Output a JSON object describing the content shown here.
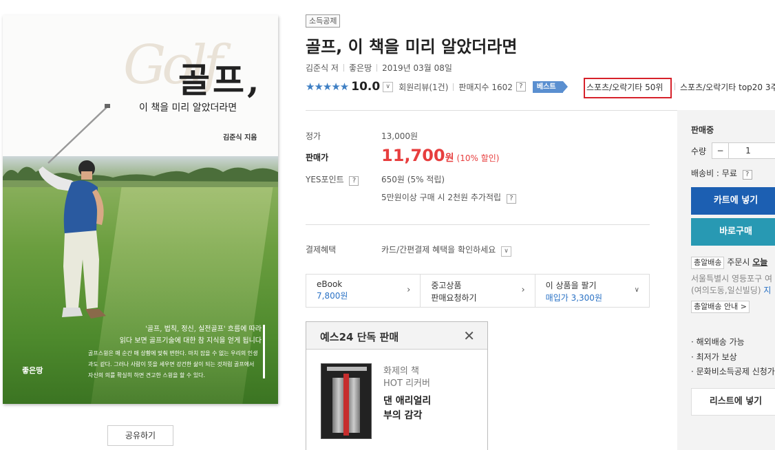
{
  "cover": {
    "script_text": "Golf",
    "title": "골프,",
    "subtitle": "이 책을 미리 알았더라면",
    "author_line": "김준식 지음",
    "blurb_line1": "'골프, 법칙, 정신, 실전골프' 흐름에 따라",
    "blurb_line2": "읽다 보면 골프기술에 대한 참 지식을 얻게 됩니다",
    "blurb_small": "골프스윙은 매 순간 매 상황에 맞춰 변한다. 마치 잡을 수 없는 우리의 인생과도 같다. 그러나 사람이 뜻을 세우면 강건한 삶이 되는 것처럼 골프에서 자신의 의를 확실히 하면 견고한 스윙을 할 수 있다.",
    "publisher_logo": "좋은땅"
  },
  "share_label": "공유하기",
  "tag": "소득공제",
  "title": "골프, 이 책을 미리 알았더라면",
  "author": "김준식 저",
  "publisher": "좋은땅",
  "pub_date": "2019년 03월 08일",
  "rating": {
    "stars": "★★★★★",
    "score": "10.0",
    "review_label": "회원리뷰(1건)",
    "sales_index": "판매지수 1602",
    "q": "?"
  },
  "best_badge": "베스트",
  "rank1": "스포츠/오락기타 50위",
  "rank2": "스포츠/오락기타 top20 3주",
  "price": {
    "list_label": "정가",
    "list_value": "13,000원",
    "sale_label": "판매가",
    "sale_num": "11,700",
    "sale_won": "원",
    "discount": "(10% 할인)",
    "point_label": "YES포인트",
    "point_value": "650원 (5% 적립)",
    "point_extra": "5만원이상 구매 시 2천원 추가적립",
    "pay_label": "결제혜택",
    "pay_value": "카드/간편결제 혜택을 확인하세요"
  },
  "side_options": [
    {
      "title": "eBook",
      "sub": "7,800원"
    },
    {
      "title": "중고상품",
      "sub": "판매요청하기"
    },
    {
      "title": "이 상품을 팔기",
      "sub": "매입가 3,300원"
    }
  ],
  "exclusive": {
    "header": "예스24 단독 판매",
    "line1": "화제의 책",
    "line2": "HOT 리커버",
    "line3": "댄 애리얼리",
    "line4": "부의 감각"
  },
  "buy": {
    "status": "판매중",
    "qty_label": "수량",
    "qty_minus": "−",
    "qty_value": "1",
    "shipping": "배송비 : 무료",
    "cart_btn": "카트에 넣기",
    "buy_btn": "바로구매",
    "delivery_chip": "총알배송",
    "delivery_text": "주문시",
    "delivery_today": "오늘",
    "address1": "서울특별시 영등포구 여",
    "address2": "(여의도동,일신빌딩)",
    "address2_link": "지",
    "delivery_guide": "총알배송 안내 >",
    "bullet1": "· 해외배송 가능",
    "bullet2": "· 최저가 보상",
    "bullet3": "· 문화비소득공제 신청가",
    "list_btn": "리스트에 넣기"
  }
}
